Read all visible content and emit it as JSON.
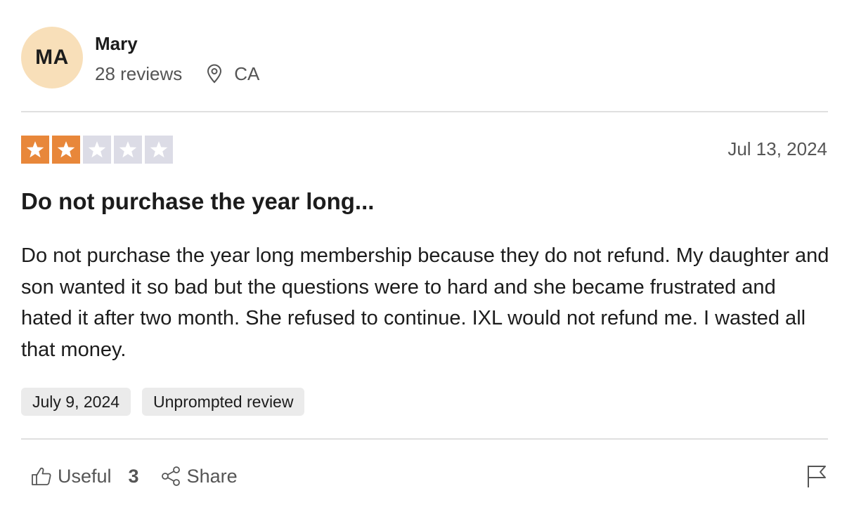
{
  "reviewer": {
    "initials": "MA",
    "name": "Mary",
    "reviews_count": "28 reviews",
    "location": "CA",
    "avatar_color": "#f8dfb9"
  },
  "rating": {
    "stars": 2,
    "max": 5,
    "filled_color": "#e8873a",
    "empty_color": "#dcdce6"
  },
  "review": {
    "date": "Jul 13, 2024",
    "title": "Do not purchase the year long...",
    "text": "Do not purchase the year long membership because they do not refund. My daughter and son wanted it so bad but the questions were to hard and she became frustrated and hated it after two month. She refused to continue. IXL would not refund me. I wasted all that money."
  },
  "tags": {
    "experience_date": "July 9, 2024",
    "review_type": "Unprompted review"
  },
  "actions": {
    "useful_label": "Useful",
    "useful_count": "3",
    "share_label": "Share",
    "icons": [
      "thumbs-up-icon",
      "share-icon",
      "flag-icon",
      "location-pin-icon",
      "star-icon"
    ]
  }
}
